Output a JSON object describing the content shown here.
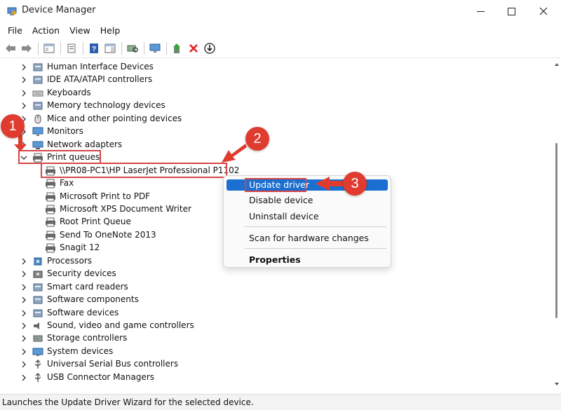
{
  "window": {
    "title": "Device Manager",
    "icon": "device-manager-icon"
  },
  "menu": [
    "File",
    "Action",
    "View",
    "Help"
  ],
  "toolbar": {
    "icons": [
      "back-arrow-icon",
      "forward-arrow-icon",
      "show-hide-console-tree-icon",
      "properties-icon",
      "help-icon",
      "action-pane-icon",
      "scan-hardware-icon",
      "monitor-icon",
      "update-driver-icon",
      "uninstall-icon",
      "download-icon"
    ]
  },
  "tree": {
    "items": [
      {
        "label": "Human Interface Devices",
        "icon": "hid-icon",
        "level": 0,
        "expanded": false
      },
      {
        "label": "IDE ATA/ATAPI controllers",
        "icon": "ide-icon",
        "level": 0,
        "expanded": false
      },
      {
        "label": "Keyboards",
        "icon": "keyboard-icon",
        "level": 0,
        "expanded": false
      },
      {
        "label": "Memory technology devices",
        "icon": "memory-icon",
        "level": 0,
        "expanded": false
      },
      {
        "label": "Mice and other pointing devices",
        "icon": "mouse-icon",
        "level": 0,
        "expanded": false
      },
      {
        "label": "Monitors",
        "icon": "monitor-icon",
        "level": 0,
        "expanded": false
      },
      {
        "label": "Network adapters",
        "icon": "network-icon",
        "level": 0,
        "expanded": false
      },
      {
        "label": "Print queues",
        "icon": "printer-icon",
        "level": 0,
        "expanded": true
      },
      {
        "label": "\\\\PR08-PC1\\HP LaserJet Professional P1102",
        "icon": "printer-icon",
        "level": 1,
        "selected": true
      },
      {
        "label": "Fax",
        "icon": "printer-icon",
        "level": 1
      },
      {
        "label": "Microsoft Print to PDF",
        "icon": "printer-icon",
        "level": 1
      },
      {
        "label": "Microsoft XPS Document Writer",
        "icon": "printer-icon",
        "level": 1
      },
      {
        "label": "Root Print Queue",
        "icon": "printer-icon",
        "level": 1
      },
      {
        "label": "Send To OneNote 2013",
        "icon": "printer-icon",
        "level": 1
      },
      {
        "label": "Snagit 12",
        "icon": "printer-icon",
        "level": 1
      },
      {
        "label": "Processors",
        "icon": "processor-icon",
        "level": 0,
        "expanded": false
      },
      {
        "label": "Security devices",
        "icon": "security-icon",
        "level": 0,
        "expanded": false
      },
      {
        "label": "Smart card readers",
        "icon": "smart-card-icon",
        "level": 0,
        "expanded": false
      },
      {
        "label": "Software components",
        "icon": "software-component-icon",
        "level": 0,
        "expanded": false
      },
      {
        "label": "Software devices",
        "icon": "software-device-icon",
        "level": 0,
        "expanded": false
      },
      {
        "label": "Sound, video and game controllers",
        "icon": "sound-icon",
        "level": 0,
        "expanded": false
      },
      {
        "label": "Storage controllers",
        "icon": "storage-icon",
        "level": 0,
        "expanded": false
      },
      {
        "label": "System devices",
        "icon": "system-icon",
        "level": 0,
        "expanded": false
      },
      {
        "label": "Universal Serial Bus controllers",
        "icon": "usb-icon",
        "level": 0,
        "expanded": false
      },
      {
        "label": "USB Connector Managers",
        "icon": "usb-icon",
        "level": 0,
        "expanded": false
      }
    ]
  },
  "context_menu": {
    "items": [
      "Update driver",
      "Disable device",
      "Uninstall device",
      "Scan for hardware changes",
      "Properties"
    ],
    "active_item": "Update driver"
  },
  "annotations": {
    "step_labels": [
      "1",
      "2",
      "3"
    ],
    "marker_color": "#e03b2f",
    "box_color": "#d64545"
  },
  "status_bar": {
    "text": "Launches the Update Driver Wizard for the selected device."
  },
  "colors": {
    "menu_highlight": "#1a6fd0"
  }
}
